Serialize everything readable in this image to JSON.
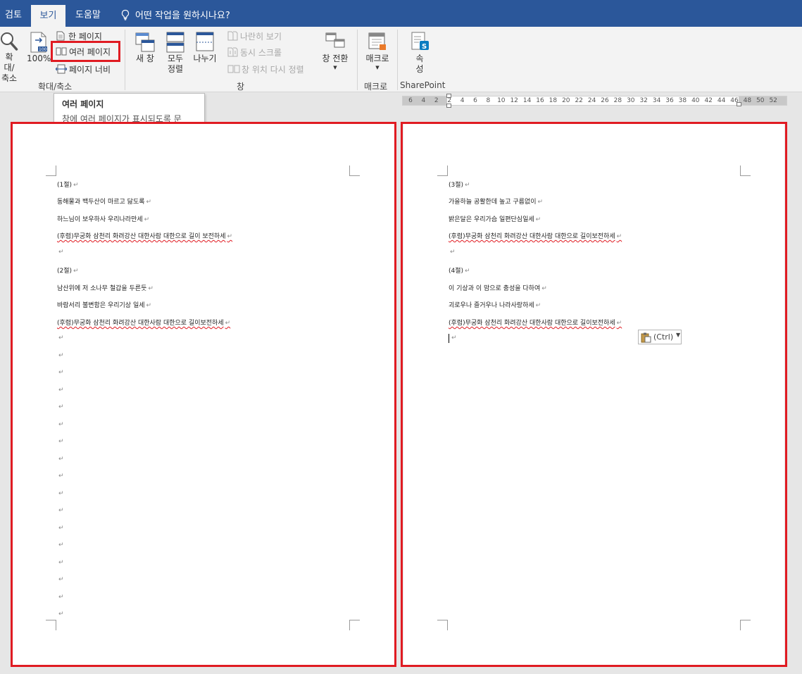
{
  "tabs": {
    "review": "검토",
    "view": "보기",
    "help": "도움말",
    "tell_me": "어떤 작업을 원하시나요?"
  },
  "ribbon": {
    "zoom": "확대/축소",
    "zoom_100": "100%",
    "one_page": "한 페이지",
    "multiple_pages": "여러 페이지",
    "page_width": "페이지 너비",
    "zoom_group": "확대/축소",
    "new_window": "새 창",
    "arrange_all": "모두 정렬",
    "split": "나누기",
    "view_side_by_side": "나란히 보기",
    "sync_scroll": "동시 스크롤",
    "reset_window_position": "창 위치 다시 정렬",
    "switch_windows": "창 전환",
    "window_group": "창",
    "macros": "매크로",
    "macros_group": "매크로",
    "properties": "속성",
    "sharepoint_group": "SharePoint"
  },
  "tooltip": {
    "title": "여러 페이지",
    "description": "창에 여러 페이지가 표시되도록 문서를 축소합니다."
  },
  "ruler_ticks": [
    "6",
    "4",
    "2",
    "2",
    "4",
    "6",
    "8",
    "10",
    "12",
    "14",
    "16",
    "18",
    "20",
    "22",
    "24",
    "26",
    "28",
    "30",
    "32",
    "34",
    "36",
    "38",
    "40",
    "42",
    "44",
    "46",
    "48",
    "50",
    "52"
  ],
  "paste_options": {
    "label": "(Ctrl)"
  },
  "pages": {
    "left": {
      "lines": [
        "(1절)",
        "동해물과 백두산이 마르고 닳도록",
        "하느님이 보우하사 우리나라만세",
        "(후렴)무궁화 삼천리 화려강산 대한사람 대한으로 길이 보전하세",
        "",
        "(2절)",
        "남산위에 저 소나무 철갑을 두른듯",
        "바람서리 불변함은 우리기상 일세",
        "(후렴)무궁화 삼천리 화려강산 대한사람 대한으로 길이보전하세"
      ],
      "empty_paragraphs": 17
    },
    "right": {
      "lines": [
        "(3절)",
        "가을하늘 공활한데 높고 구름없이",
        "밝은달은 우리가슴 일편단심일세",
        "(후렴)무궁화 삼천리 화려강산 대한사람 대한으로 길이보전하세",
        "",
        "(4절)",
        "이 기상과 이 맘으로 충성을 다하여",
        "괴로우나 즐거우나 나라사랑하세",
        "(후렴)무궁화 삼천리 화려강산 대한사람 대한으로 길이보전하세"
      ]
    }
  },
  "colors": {
    "ribbon_blue": "#2b579a",
    "highlight_red": "#e01b22",
    "page_background": "#e6e6e6"
  }
}
